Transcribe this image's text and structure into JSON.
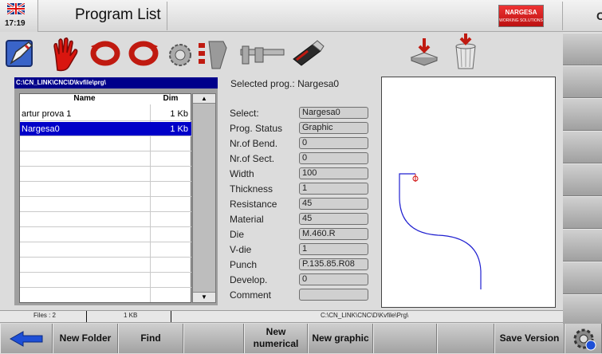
{
  "header": {
    "time": "17:19",
    "title": "Program List",
    "brand_line1": "NARGESA",
    "brand_line2": "WORKING SOLUTIONS",
    "right_char": "C"
  },
  "toolbar": {
    "icons": [
      "edit-icon",
      "hand-icon",
      "rotate-left-icon",
      "rotate-right-icon",
      "tools-icon",
      "list-edit-icon",
      "caliper-icon",
      "usb-icon",
      "save-icon",
      "trash-icon"
    ]
  },
  "files": {
    "path": "C:\\CN_LINK\\CNC\\D\\kvfile\\prg\\",
    "col_name": "Name",
    "col_dim": "Dim",
    "rows": [
      {
        "name": "artur prova 1",
        "dim": "1 Kb"
      },
      {
        "name": "Nargesa0",
        "dim": "1 Kb"
      }
    ]
  },
  "info": {
    "selected_label": "Selected prog.:",
    "selected_value": "Nargesa0",
    "fields": [
      {
        "label": "Select:",
        "value": "Nargesa0"
      },
      {
        "label": "Prog. Status",
        "value": "Graphic"
      },
      {
        "label": "Nr.of Bend.",
        "value": "0"
      },
      {
        "label": "Nr.of Sect.",
        "value": "0"
      },
      {
        "label": "Width",
        "value": "100"
      },
      {
        "label": "Thickness",
        "value": "1"
      },
      {
        "label": "Resistance",
        "value": "45"
      },
      {
        "label": "Material",
        "value": "45"
      },
      {
        "label": "Die",
        "value": "M.460.R"
      },
      {
        "label": "V-die",
        "value": "1"
      },
      {
        "label": "Punch",
        "value": "P.135.85.R08"
      },
      {
        "label": "Develop.",
        "value": "0"
      },
      {
        "label": "Comment",
        "value": ""
      }
    ]
  },
  "status": {
    "files": "Files : 2",
    "size": "1 KB",
    "path": "C:\\CN_LINK\\CNC\\D\\Kvfile\\Prg\\"
  },
  "bottom": {
    "new_folder": "New Folder",
    "find": "Find",
    "new_numerical_1": "New",
    "new_numerical_2": "numerical",
    "new_graphic": "New graphic",
    "save_version": "Save Version"
  },
  "colors": {
    "selection": "#0000c8",
    "path_bar": "#00008b",
    "profile_line": "#2020d0",
    "arrow": "#1e4fd6"
  }
}
